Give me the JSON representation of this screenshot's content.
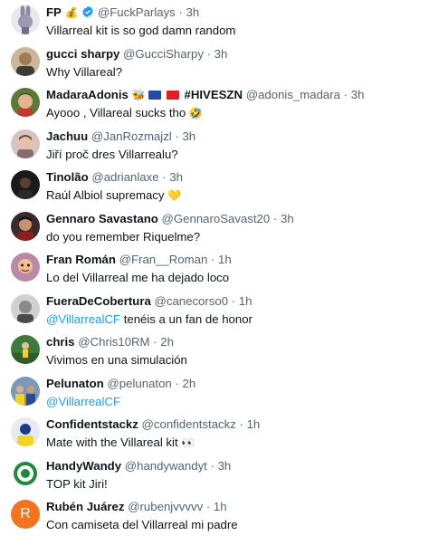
{
  "colors": {
    "name": "#0f1419",
    "meta": "#536471",
    "link": "#1d9bf0",
    "verified": "#1d9bf0"
  },
  "replies": [
    {
      "name": "FP",
      "name_emoji": "💰",
      "verified": true,
      "handle": "@FuckParlays",
      "time": "3h",
      "text": "Villarreal kit is so god damn random",
      "avatar": "rabbit-avatar"
    },
    {
      "name": "gucci sharpy",
      "handle": "@GucciSharpy",
      "time": "3h",
      "text": "Why Villareal?",
      "avatar": "man-avatar"
    },
    {
      "name": "MadaraAdonis",
      "name_emoji": "🐝",
      "name_suffix": "#HIVESZN",
      "handle": "@adonis_madara",
      "time": "3h",
      "text": "Ayooo , Villareal sucks tho",
      "text_emoji": "🤣",
      "avatar": "anime-avatar"
    },
    {
      "name": "Jachuu",
      "handle": "@JanRozmajzl",
      "time": "3h",
      "text": "Jiří proč dres Villarrealu?",
      "avatar": "person-avatar"
    },
    {
      "name": "Tinolão",
      "handle": "@adrianlaxe",
      "time": "3h",
      "text": "Raúl Albiol supremacy",
      "text_emoji": "💛",
      "avatar": "dark-avatar"
    },
    {
      "name": "Gennaro Savastano",
      "handle": "@GennaroSavast20",
      "time": "3h",
      "text": "do you remember Riquelme?",
      "avatar": "gennaro-avatar"
    },
    {
      "name": "Fran Román",
      "handle": "@Fran__Roman",
      "time": "1h",
      "text": "Lo del Villarreal me ha dejado loco",
      "avatar": "fran-avatar"
    },
    {
      "name": "FueraDeCobertura",
      "handle": "@canecorso0",
      "time": "1h",
      "mention": "@VillarrealCF",
      "text": " tenéis a un fan de honor",
      "avatar": "bw-avatar"
    },
    {
      "name": "chris",
      "handle": "@Chris10RM",
      "time": "2h",
      "text": "Vivimos en una simulación",
      "avatar": "field-avatar"
    },
    {
      "name": "Pelunaton",
      "handle": "@pelunaton",
      "time": "2h",
      "mention": "@VillarrealCF",
      "text": "",
      "avatar": "group-avatar"
    },
    {
      "name": "Confidentstackz",
      "handle": "@confidentstackz",
      "time": "1h",
      "text": "Mate with the Villareal kit",
      "text_emoji": "👀",
      "avatar": "stackz-avatar"
    },
    {
      "name": "HandyWandy",
      "handle": "@handywandyt",
      "time": "3h",
      "text": "TOP kit Jiri!",
      "avatar": "badge-avatar"
    },
    {
      "name": "Rubén Juárez",
      "handle": "@rubenjvvvvv",
      "time": "1h",
      "text": "Con camiseta del Villarreal mi padre",
      "avatar": "letter-avatar",
      "avatar_letter": "R"
    }
  ]
}
